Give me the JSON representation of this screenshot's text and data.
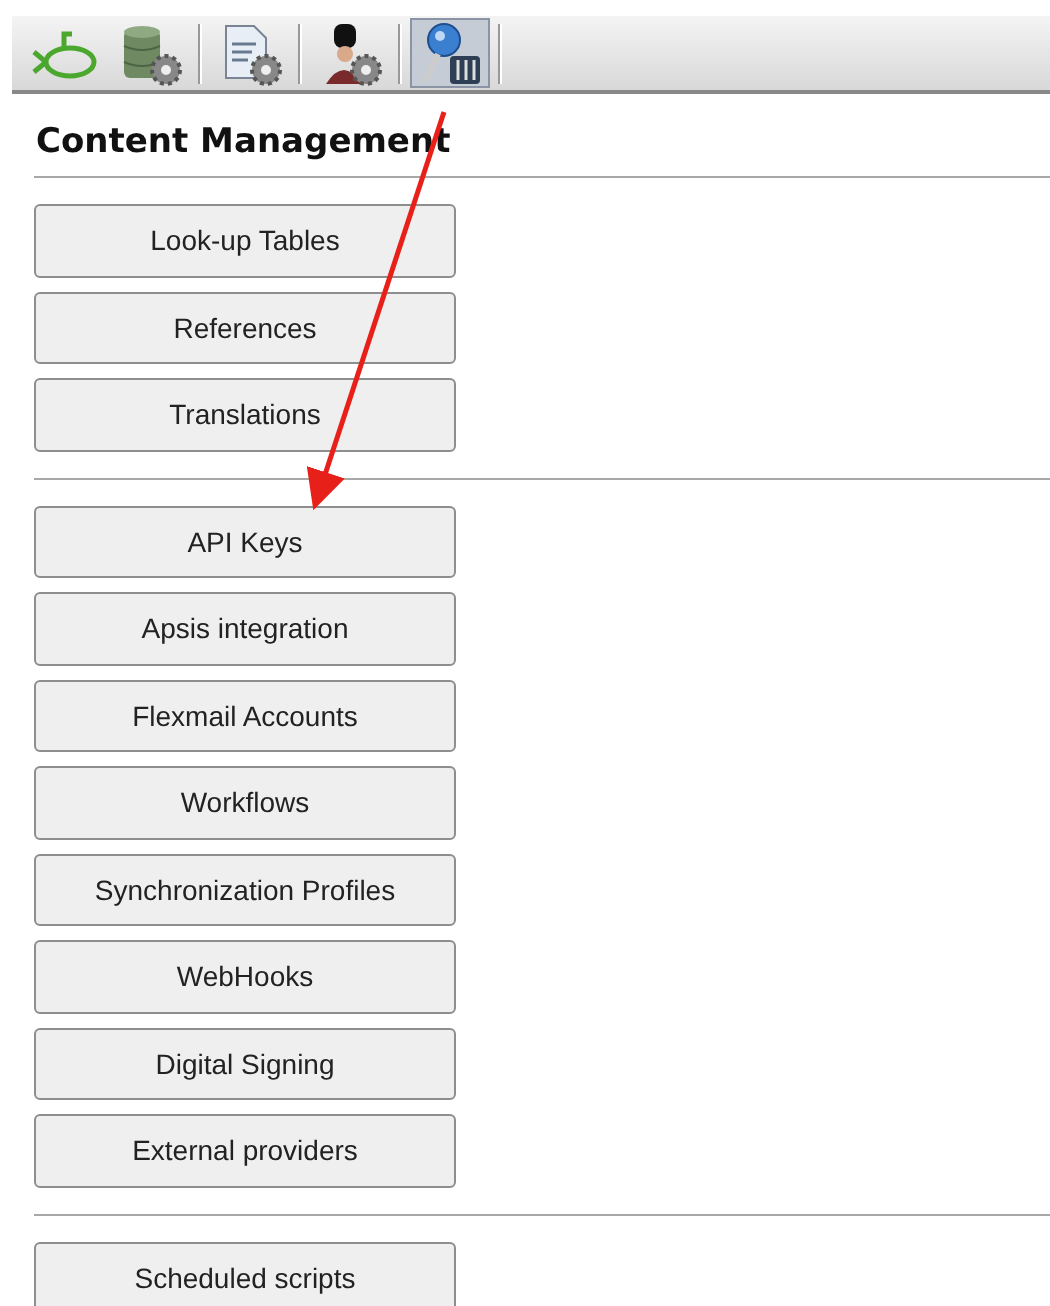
{
  "toolbar": {
    "tools": [
      {
        "kind": "submarine",
        "selected": false
      },
      {
        "kind": "database",
        "selected": false
      },
      {
        "kind": "document",
        "selected": false
      },
      {
        "kind": "guard",
        "selected": false
      },
      {
        "kind": "key",
        "selected": true
      }
    ]
  },
  "title": "Content Management",
  "groups": [
    {
      "buttons": [
        "Look-up Tables",
        "References",
        "Translations"
      ]
    },
    {
      "buttons": [
        "API Keys",
        "Apsis integration",
        "Flexmail Accounts",
        "Workflows",
        "Synchronization Profiles",
        "WebHooks",
        "Digital Signing",
        "External providers"
      ]
    },
    {
      "buttons": [
        "Scheduled scripts"
      ]
    }
  ]
}
